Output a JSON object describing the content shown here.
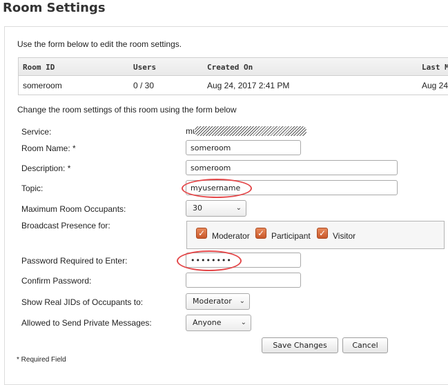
{
  "page": {
    "title": "Room Settings"
  },
  "intro": "Use the form below to edit the room settings.",
  "room_table": {
    "headers": [
      "Room ID",
      "Users",
      "Created On",
      "Last M"
    ],
    "row": [
      "someroom",
      "0 / 30",
      "Aug 24, 2017 2:41 PM",
      "Aug 24"
    ]
  },
  "form": {
    "subtitle": "Change the room settings of this room using the form below",
    "service": {
      "label": "Service:",
      "value": "muc"
    },
    "room_name": {
      "label": "Room Name: *",
      "value": "someroom"
    },
    "description": {
      "label": "Description: *",
      "value": "someroom"
    },
    "topic": {
      "label": "Topic:",
      "value": "myusername"
    },
    "max_occupants": {
      "label": "Maximum Room Occupants:",
      "value": "30"
    },
    "broadcast": {
      "label": "Broadcast Presence for:",
      "options": [
        {
          "label": "Moderator",
          "checked": true
        },
        {
          "label": "Participant",
          "checked": true
        },
        {
          "label": "Visitor",
          "checked": true
        }
      ]
    },
    "password": {
      "label": "Password Required to Enter:",
      "value": "••••••••"
    },
    "confirm_password": {
      "label": "Confirm Password:",
      "value": ""
    },
    "show_jids": {
      "label": "Show Real JIDs of Occupants to:",
      "value": "Moderator"
    },
    "private_messages": {
      "label": "Allowed to Send Private Messages:",
      "value": "Anyone"
    },
    "save_label": "Save Changes",
    "cancel_label": "Cancel",
    "required_note": "* Required Field"
  },
  "colors": {
    "annotation": "#e4484a",
    "checkbox": "#d0632f",
    "border": "#dcdcdc"
  },
  "icons": {
    "checkbox": "check-icon",
    "select_arrow": "chevron-down-icon"
  }
}
